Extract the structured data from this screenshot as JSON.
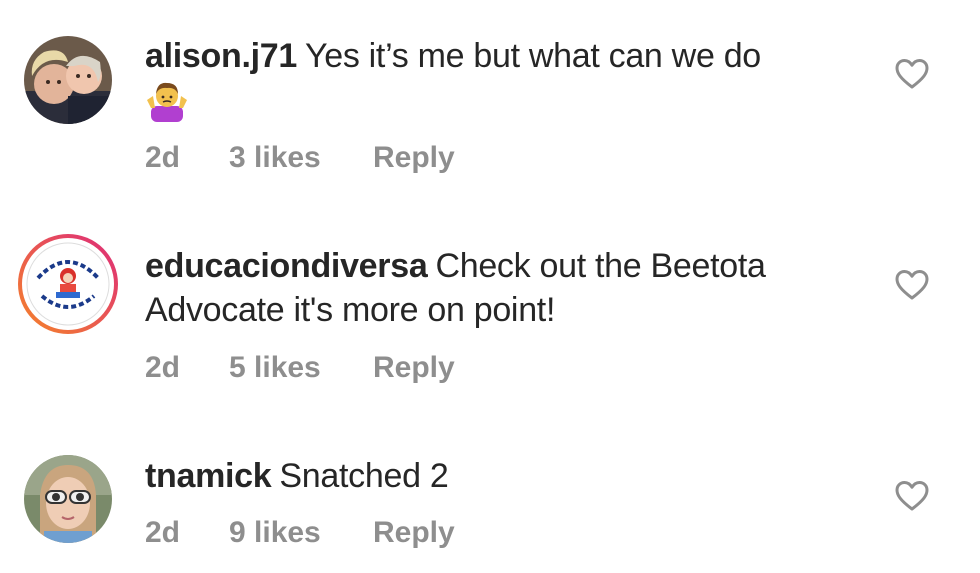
{
  "comments": [
    {
      "username": "alison.j71",
      "text": "Yes it’s me but what can we do",
      "emoji": "person-shrugging-emoji",
      "time": "2d",
      "likes": "3 likes",
      "reply": "Reply",
      "avatar": "avatar-photo-two-women"
    },
    {
      "username": "educaciondiversa",
      "text": "Check out the Beetota Advocate it's more on point!",
      "time": "2d",
      "likes": "5 likes",
      "reply": "Reply",
      "avatar": "educaciondiversa-logo"
    },
    {
      "username": "tnamick",
      "text": "Snatched 2",
      "time": "2d",
      "likes": "9 likes",
      "reply": "Reply",
      "avatar": "avatar-photo-girl-sunglasses"
    }
  ],
  "colors": {
    "text": "#262626",
    "meta": "#8e8e8e",
    "heart": "#8e8e8e",
    "story_ring_start": "#f58529",
    "story_ring_end": "#dd2a7b"
  }
}
